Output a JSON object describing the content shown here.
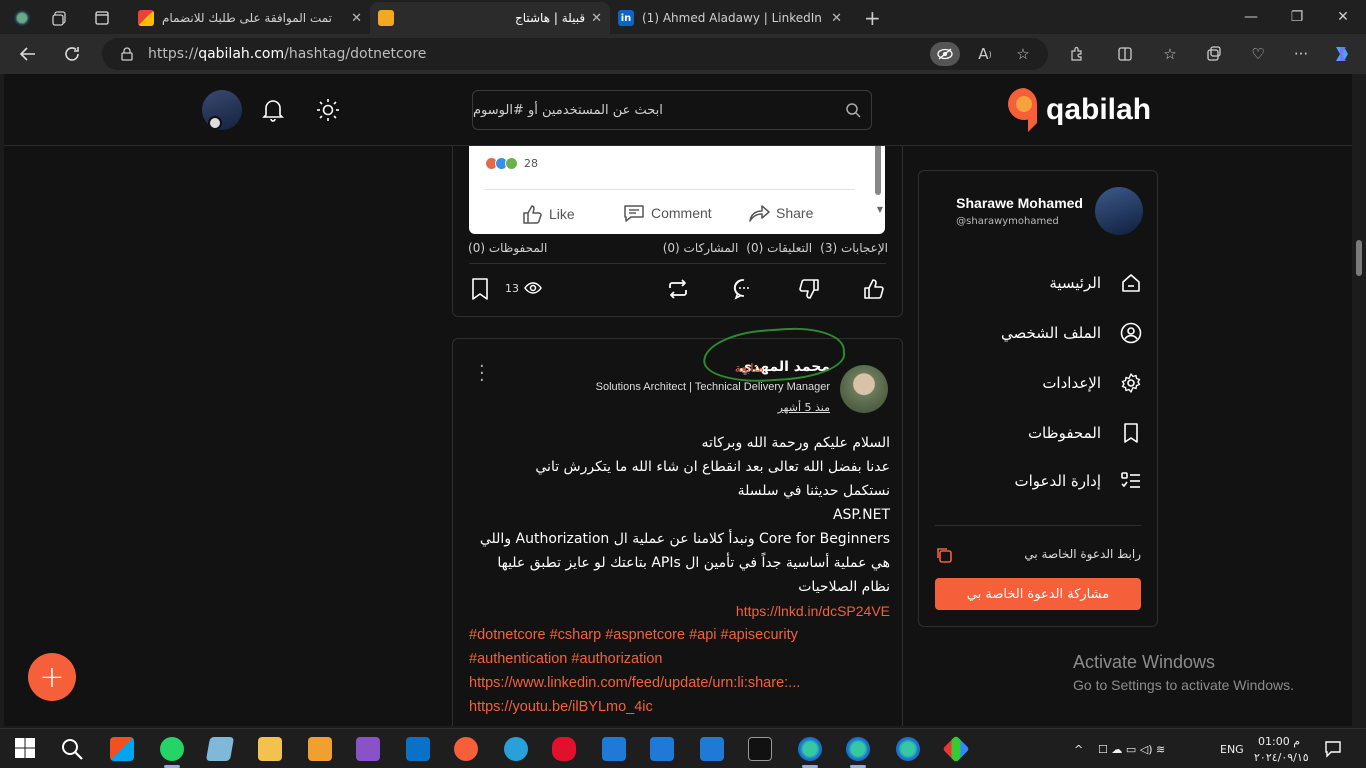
{
  "browser": {
    "tabs": [
      {
        "title": "تمت الموافقة على طلبك للانضمام"
      },
      {
        "title": "قبيلة | هاشتاج"
      },
      {
        "title": "(1) Ahmed Aladawy | LinkedIn"
      }
    ],
    "url_scheme": "https://",
    "url_host": "qabilah.com",
    "url_path": "/hashtag/dotnetcore"
  },
  "site": {
    "logo_text": "qabilah",
    "search_placeholder": "ابحث عن المستخدمين أو #الوسوم"
  },
  "sidebar": {
    "user_name": "Sharawe Mohamed",
    "user_handle": "@sharawymohamed",
    "menu": [
      {
        "label": "الرئيسية",
        "icon": "home-icon"
      },
      {
        "label": "الملف الشخصي",
        "icon": "user-icon"
      },
      {
        "label": "الإعدادات",
        "icon": "gear-icon"
      },
      {
        "label": "المحفوظات",
        "icon": "bookmark-icon"
      },
      {
        "label": "إدارة الدعوات",
        "icon": "list-check-icon"
      }
    ],
    "invite_label": "رابط الدعوة الخاصة بي",
    "invite_button": "مشاركة الدعوة الخاصة بي"
  },
  "post1": {
    "embed_reaction_count": "28",
    "embed_actions": [
      "Like",
      "Comment",
      "Share"
    ],
    "likes": "الإعجابات (3)",
    "comments": "التعليقات (0)",
    "shares": "المشاركات (0)",
    "saves": "المحفوظات (0)",
    "views": "13"
  },
  "post2": {
    "author_name": "محمد المهدي",
    "follow_label": "متابعة",
    "author_title": "Solutions Architect | Technical Delivery Manager",
    "time": "منذ 5 أشهر",
    "body_lines": [
      "السلام عليكم ورحمة الله وبركاته",
      "عدنا بفضل الله تعالى بعد انقطاع ان شاء الله ما يتكررش تاني",
      "نستكمل حديثنا في سلسلة",
      "ASP.NET",
      "Core for Beginners ونبدأ كلامنا عن عملية ال Authorization واللي",
      "هي عملية أساسية جداً في تأمين ال APIs بتاعتك لو عايز تطبق عليها",
      "نظام الصلاحيات",
      "https://lnkd.in/dcSP24VE"
    ],
    "tag_lines": [
      "#dotnetcore #csharp #aspnetcore #api #apisecurity",
      "#authentication #authorization",
      "https://www.linkedin.com/feed/update/urn:li:share:...",
      "https://youtu.be/ilBYLmo_4ic"
    ]
  },
  "watermark": {
    "line1": "Activate Windows",
    "line2": "Go to Settings to activate Windows."
  },
  "taskbar": {
    "lang": "ENG",
    "time": "01:00 م",
    "date": "٢٠٢٤/٠٩/١٥"
  },
  "colors": {
    "accent": "#f5603a",
    "background": "#121212",
    "annotation": "#2f8a2f"
  }
}
